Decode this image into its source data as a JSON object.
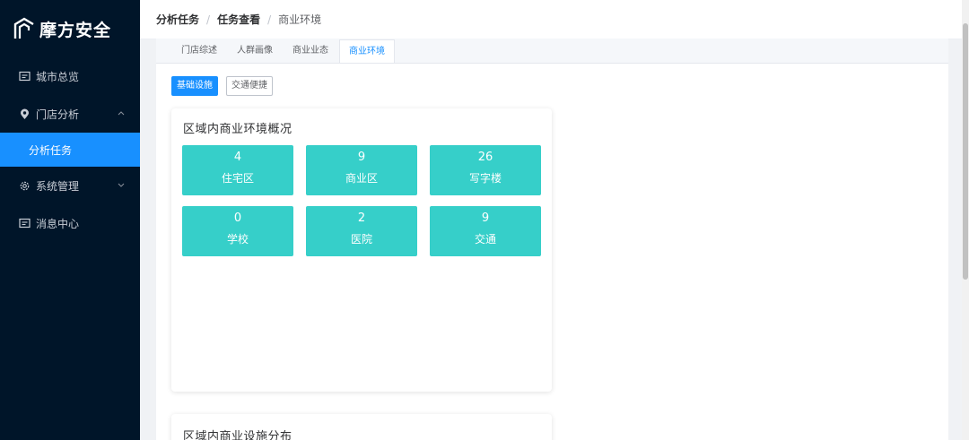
{
  "brand": {
    "name": "摩方安全"
  },
  "sidebar": {
    "items": [
      {
        "label": "城市总览",
        "icon": "message-square-icon"
      },
      {
        "label": "门店分析",
        "icon": "location-pin-icon"
      },
      {
        "label": "分析任务",
        "icon": ""
      },
      {
        "label": "系统管理",
        "icon": "gear-icon"
      },
      {
        "label": "消息中心",
        "icon": "message-square-icon"
      }
    ],
    "active_color": "#1890ff",
    "bg_color": "#001529"
  },
  "breadcrumb": [
    "分析任务",
    "任务查看",
    "商业环境"
  ],
  "tabs": [
    "门店综述",
    "人群画像",
    "商业业态",
    "商业环境"
  ],
  "active_tab": "商业环境",
  "buttons": {
    "primary": "基础设施",
    "secondary": "交通便捷"
  },
  "overview": {
    "title": "区域内商业环境概况",
    "tiles": [
      {
        "value": "4",
        "label": "住宅区"
      },
      {
        "value": "9",
        "label": "商业区"
      },
      {
        "value": "26",
        "label": "写字楼"
      },
      {
        "value": "0",
        "label": "学校"
      },
      {
        "value": "2",
        "label": "医院"
      },
      {
        "value": "9",
        "label": "交通"
      }
    ],
    "tile_color": "#36cfc9"
  },
  "distribution": {
    "title": "区域内商业设施分布"
  }
}
